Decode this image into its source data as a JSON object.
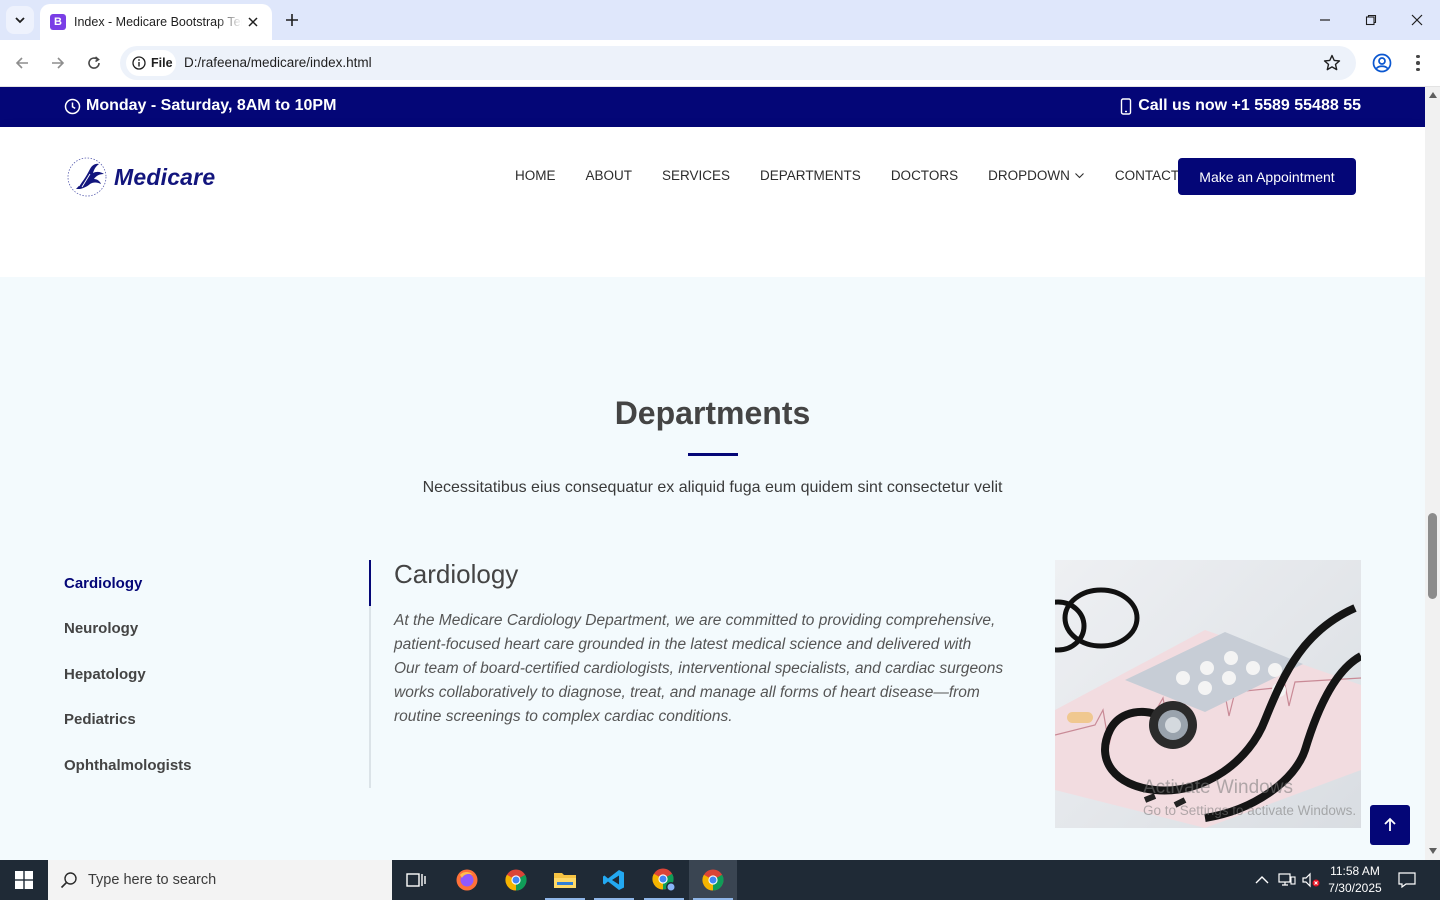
{
  "browser": {
    "tab_title": "Index - Medicare Bootstrap Template",
    "favicon_letter": "B",
    "file_chip": "File",
    "url": "D:/rafeena/medicare/index.html"
  },
  "topbar": {
    "hours": "Monday - Saturday, 8AM to 10PM",
    "phone": "Call us now +1 5589 55488 55"
  },
  "header": {
    "logo_text": "Medicare",
    "nav": [
      "HOME",
      "ABOUT",
      "SERVICES",
      "DEPARTMENTS",
      "DOCTORS",
      "DROPDOWN",
      "CONTACT"
    ],
    "cta": "Make an Appointment"
  },
  "departments": {
    "title": "Departments",
    "subtitle": "Necessitatibus eius consequatur ex aliquid fuga eum quidem sint consectetur velit",
    "tabs": [
      "Cardiology",
      "Neurology",
      "Hepatology",
      "Pediatrics",
      "Ophthalmologists"
    ],
    "active_tab": "Cardiology",
    "detail_title": "Cardiology",
    "detail_lines": [
      "At the Medicare Cardiology Department, we are committed to providing comprehensive,",
      "patient-focused heart care grounded in the latest medical science and delivered with",
      "Our team of board-certified cardiologists, interventional specialists, and cardiac surgeons",
      "works collaboratively to diagnose, treat, and manage all forms of heart disease—from",
      "routine screenings to complex cardiac conditions."
    ]
  },
  "watermark": {
    "line1": "Activate Windows",
    "line2": "Go to Settings to activate Windows."
  },
  "taskbar": {
    "search_placeholder": "Type here to search",
    "time": "11:58 AM",
    "date": "7/30/2025"
  },
  "colors": {
    "brand": "#040677",
    "section_bg": "#f3fafd",
    "taskbar": "#1f2a36"
  }
}
